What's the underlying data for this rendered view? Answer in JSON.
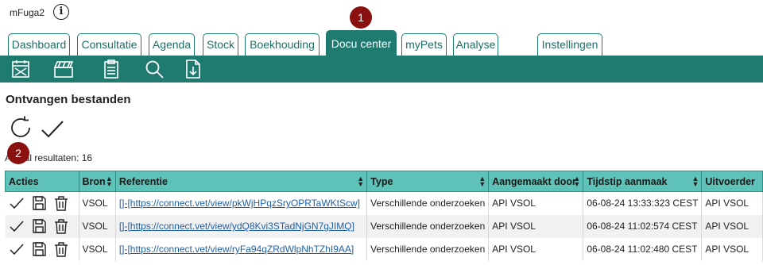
{
  "app": {
    "title": "mFuga2",
    "info_glyph": "i"
  },
  "tabs": [
    {
      "label": "Dashboard",
      "active": false
    },
    {
      "label": "Consultatie",
      "active": false
    },
    {
      "label": "Agenda",
      "active": false
    },
    {
      "label": "Stock",
      "active": false
    },
    {
      "label": "Boekhouding",
      "active": false
    },
    {
      "label": "Docu center",
      "active": true
    },
    {
      "label": "myPets",
      "active": false
    },
    {
      "label": "Analyse",
      "active": false
    },
    {
      "label": "Instellingen",
      "active": false
    }
  ],
  "toolbar": {
    "icons": [
      "calendar-cross-icon",
      "clapperboard-icon",
      "clipboard-list-icon",
      "search-icon",
      "file-download-icon"
    ]
  },
  "page": {
    "title": "Ontvangen bestanden",
    "result_count": "Aantal resultaten: 16"
  },
  "badges": {
    "tab_badge": "1",
    "refresh_badge": "2"
  },
  "table": {
    "columns": [
      "Acties",
      "Bron",
      "Referentie",
      "Type",
      "Aangemaakt door",
      "Tijdstip aanmaak",
      "Uitvoerder"
    ],
    "rows": [
      {
        "bron": "VSOL",
        "referentie": "[]-[https://connect.vet/view/pkWjHPqzSryOPRTaWKtScw]",
        "type": "Verschillende onderzoeken",
        "aangemaakt_door": "API VSOL",
        "tijdstip": "06-08-24 13:33:323 CEST",
        "uitvoerder": "API VSOL"
      },
      {
        "bron": "VSOL",
        "referentie": "[]-[https://connect.vet/view/ydQ8Kvi3STadNjGN7gJIMQ]",
        "type": "Verschillende onderzoeken",
        "aangemaakt_door": "API VSOL",
        "tijdstip": "06-08-24 11:02:574 CEST",
        "uitvoerder": "API VSOL"
      },
      {
        "bron": "VSOL",
        "referentie": "[]-[https://connect.vet/view/ryFa94qZRdWlpNhTZhI9AA]",
        "type": "Verschillende onderzoeken",
        "aangemaakt_door": "API VSOL",
        "tijdstip": "06-08-24 11:02:480 CEST",
        "uitvoerder": "API VSOL"
      }
    ]
  },
  "colors": {
    "teal": "#1f7a70",
    "header_teal": "#5fc2b8",
    "badge_red": "#8b1111",
    "link": "#1f5fa8"
  }
}
